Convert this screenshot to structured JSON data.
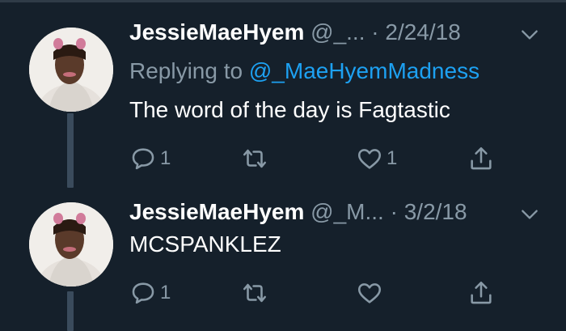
{
  "tweets": [
    {
      "name": "JessieMaeHyem",
      "handle": "@_...",
      "date": "· 2/24/18",
      "replying_prefix": "Replying to",
      "replying_mention": "@_MaeHyemMadness",
      "text": "The word of the day is Fagtastic",
      "reply_count": "1",
      "retweet_count": "",
      "like_count": "1"
    },
    {
      "name": "JessieMaeHyem",
      "handle": "@_M...",
      "date": "· 3/2/18",
      "text": "MCSPANKLEZ",
      "reply_count": "1",
      "retweet_count": "",
      "like_count": ""
    }
  ],
  "colors": {
    "background": "#15202b",
    "secondary_text": "#8899a6",
    "mention": "#1da1f2",
    "thread_line": "#3a4b5c"
  },
  "icons": [
    "reply-icon",
    "retweet-icon",
    "like-icon",
    "share-icon",
    "chevron-down-icon"
  ]
}
